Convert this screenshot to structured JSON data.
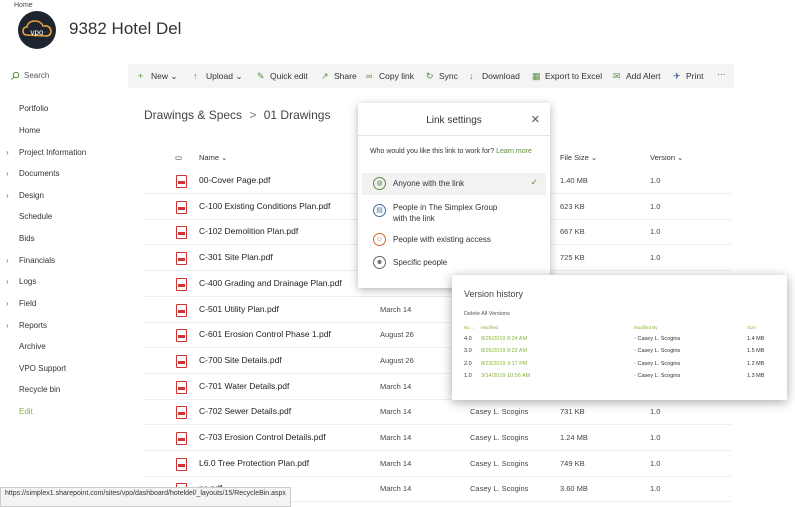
{
  "header": {
    "breadcrumb_home": "Home",
    "site_title": "9382 Hotel Del",
    "logo_text": "vpo"
  },
  "search": {
    "placeholder": "Search"
  },
  "commands": [
    {
      "label": "New",
      "icon": "plus-icon"
    },
    {
      "label": "Upload",
      "icon": "upload-icon"
    },
    {
      "label": "Quick edit",
      "icon": "pencil-icon"
    },
    {
      "label": "Share",
      "icon": "share-icon"
    },
    {
      "label": "Copy link",
      "icon": "link-icon"
    },
    {
      "label": "Sync",
      "icon": "sync-icon"
    },
    {
      "label": "Download",
      "icon": "download-icon"
    },
    {
      "label": "Export to Excel",
      "icon": "excel-icon"
    },
    {
      "label": "Add Alert",
      "icon": "alert-icon"
    },
    {
      "label": "Print",
      "icon": "print-icon"
    }
  ],
  "nav": [
    "Portfolio",
    "Home",
    "Project Information",
    "Documents",
    "Design",
    "Schedule",
    "Bids",
    "Financials",
    "Logs",
    "Field",
    "Reports",
    "Archive",
    "VPO Support",
    "Recycle bin",
    "Edit"
  ],
  "library": {
    "breadcrumb_parent": "Drawings & Specs",
    "breadcrumb_sep": ">",
    "breadcrumb_current": "01 Drawings"
  },
  "columns": {
    "name": "Name",
    "file_size": "File Size",
    "version": "Version"
  },
  "files": [
    {
      "name": "00-Cover Page.pdf",
      "modified": "",
      "by": "",
      "size": "1.40 MB",
      "version": "1.0"
    },
    {
      "name": "C-100 Existing Conditions Plan.pdf",
      "modified": "",
      "by": "",
      "size": "623 KB",
      "version": "1.0"
    },
    {
      "name": "C-102 Demolition Plan.pdf",
      "modified": "",
      "by": "",
      "size": "667 KB",
      "version": "1.0"
    },
    {
      "name": "C-301 Site Plan.pdf",
      "modified": "",
      "by": "",
      "size": "725 KB",
      "version": "1.0"
    },
    {
      "name": "C-400 Grading and Drainage Plan.pdf",
      "modified": "",
      "by": "",
      "size": "",
      "version": ""
    },
    {
      "name": "C-501 Utility Plan.pdf",
      "modified": "March 14",
      "by": "",
      "size": "",
      "version": ""
    },
    {
      "name": "C-601 Erosion Control Phase 1.pdf",
      "modified": "August 26",
      "by": "",
      "size": "",
      "version": ""
    },
    {
      "name": "C-700 Site Details.pdf",
      "modified": "August 26",
      "by": "",
      "size": "",
      "version": ""
    },
    {
      "name": "C-701 Water Details.pdf",
      "modified": "March 14",
      "by": "",
      "size": "",
      "version": ""
    },
    {
      "name": "C-702 Sewer Details.pdf",
      "modified": "March 14",
      "by": "Casey L. Scogins",
      "size": "731 KB",
      "version": "1.0"
    },
    {
      "name": "C-703 Erosion Control Details.pdf",
      "modified": "March 14",
      "by": "Casey L. Scogins",
      "size": "1.24 MB",
      "version": "1.0"
    },
    {
      "name": "L6.0 Tree Protection Plan.pdf",
      "modified": "March 14",
      "by": "Casey L. Scogins",
      "size": "749 KB",
      "version": "1.0"
    },
    {
      "name": "ns.pdf",
      "modified": "March 14",
      "by": "Casey L. Scogins",
      "size": "3.60 MB",
      "version": "1.0"
    }
  ],
  "link_settings": {
    "title": "Link settings",
    "question": "Who would you like this link to work for?",
    "learn_more": "Learn more",
    "options": [
      {
        "label": "Anyone with the link",
        "icon": "globe-icon",
        "selected": true
      },
      {
        "label": "People in The Simplex Group with the link",
        "icon": "building-icon",
        "selected": false
      },
      {
        "label": "People with existing access",
        "icon": "people-icon",
        "selected": false
      },
      {
        "label": "Specific people",
        "icon": "person-icon",
        "selected": false
      }
    ]
  },
  "version_history": {
    "title": "Version history",
    "delete_all": "Delete All Versions",
    "headers": {
      "no": "No. ↓",
      "modified": "Modified",
      "modified_by": "Modified By",
      "size": "Size"
    },
    "rows": [
      {
        "no": "4.0",
        "date": "8/26/2019 8:24 AM",
        "by": "Casey L. Scogins",
        "size": "1.4 MB"
      },
      {
        "no": "3.0",
        "date": "8/26/2019 8:22 AM",
        "by": "Casey L. Scogins",
        "size": "1.5 MB"
      },
      {
        "no": "2.0",
        "date": "8/23/2019 3:17 PM",
        "by": "Casey L. Scogins",
        "size": "1.2 MB"
      },
      {
        "no": "1.0",
        "date": "3/14/2019 10:56 AM",
        "by": "Casey L. Scogins",
        "size": "1.3 MB"
      }
    ]
  },
  "status_bar": "https://simplex1.sharepoint.com/sites/vpo/dashboard/hoteldel/_layouts/15/RecycleBin.aspx"
}
